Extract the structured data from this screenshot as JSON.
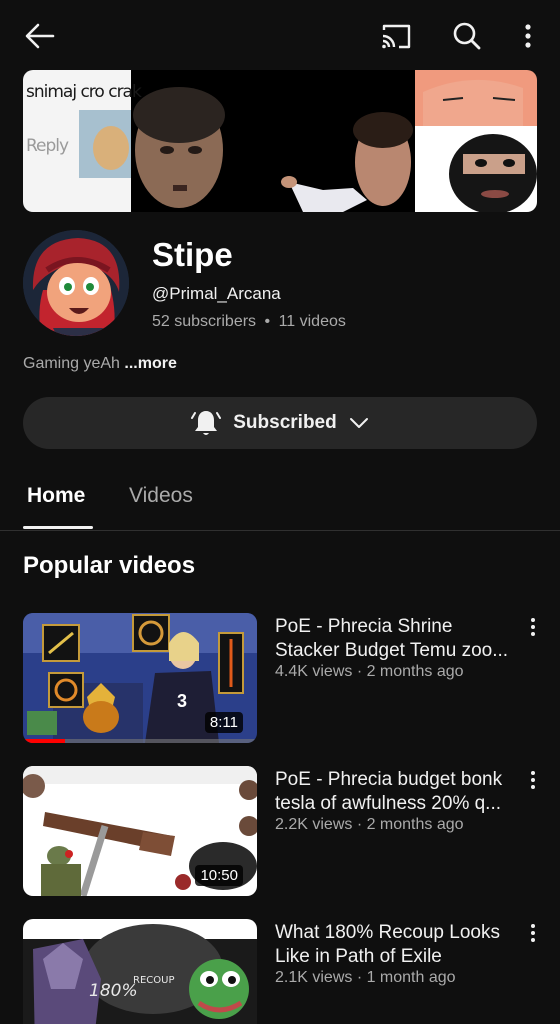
{
  "header": {
    "back_icon": "arrow-left-icon",
    "cast_icon": "cast-icon",
    "search_icon": "search-icon",
    "more_icon": "vertical-dots-icon"
  },
  "banner": {
    "caption_top": "snimaj cro crak",
    "caption_reply": "Reply"
  },
  "channel": {
    "name": "Stipe",
    "handle": "@Primal_Arcana",
    "subscribers": "52 subscribers",
    "separator": "•",
    "videos": "11 videos",
    "description": "Gaming yeAh",
    "more_label": "...more"
  },
  "subscribe": {
    "icon": "bell-icon",
    "label": "Subscribed",
    "chevron": "chevron-down-icon"
  },
  "tabs": [
    {
      "label": "Home",
      "active": true
    },
    {
      "label": "Videos",
      "active": false
    }
  ],
  "section": {
    "title": "Popular videos"
  },
  "videos": [
    {
      "title_line1": "PoE - Phrecia Shrine",
      "title_line2": "Stacker Budget Temu zoo...",
      "meta": "4.4K views · 2 months ago",
      "duration": "8:11",
      "progress": 0.18
    },
    {
      "title_line1": "PoE - Phrecia budget bonk",
      "title_line2": "tesla of awfulness 20% q...",
      "meta": "2.2K views · 2 months ago",
      "duration": "10:50",
      "progress": 0
    },
    {
      "title_line1": "What 180% Recoup Looks",
      "title_line2": "Like in Path of Exile",
      "meta": "2.1K views · 1 month ago",
      "duration": "",
      "progress": 0,
      "thumb_text": "180%",
      "thumb_text_small": "RECOUP"
    }
  ],
  "colors": {
    "background": "#0f0f0f",
    "surface": "#272727",
    "text_primary": "#f1f1f1",
    "text_secondary": "#aaaaaa",
    "progress_red": "#ff0000"
  }
}
